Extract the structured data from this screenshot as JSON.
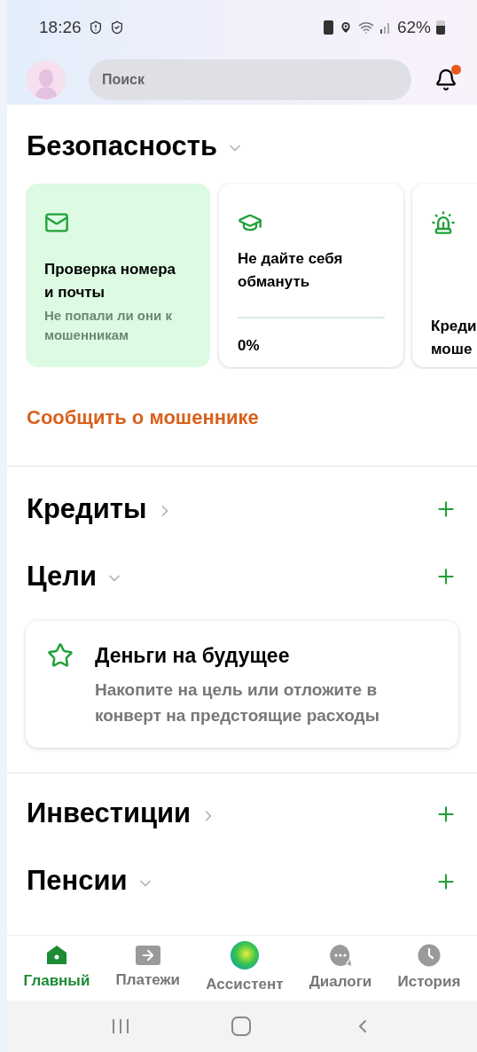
{
  "status_bar": {
    "time": "18:26",
    "battery": "62%"
  },
  "header": {
    "search": {
      "placeholder": "Поиск"
    },
    "notification_dot": true
  },
  "security": {
    "title": "Безопасность",
    "expanded": true,
    "cards": [
      {
        "kind": "check",
        "title": "Проверка номера и почты",
        "subtitle": "Не попали ли они к мошенникам",
        "selected": true
      },
      {
        "kind": "progress",
        "title": "Не дайте себя обмануть",
        "level": 0,
        "reading": "0%",
        "selected": false
      },
      {
        "kind": "alarm",
        "title": "Креди моше",
        "selected": false
      }
    ],
    "report_link": "Сообщить о мошеннике"
  },
  "sections": [
    {
      "kind": "plain",
      "title": "Кредиты",
      "expanded": false
    },
    {
      "kind": "goal",
      "title": "Цели",
      "expanded": true,
      "card": {
        "title": "Деньги на будущее",
        "text": "Накопите на цель или отложите в конверт на предстоящие расходы"
      }
    },
    {
      "kind": "plain",
      "title": "Инвестиции",
      "expanded": false,
      "divider_before": true
    },
    {
      "kind": "plain",
      "title": "Пенсии",
      "expanded": true
    }
  ],
  "tabs": [
    {
      "kind": "home",
      "label": "Главный",
      "selected": true
    },
    {
      "kind": "payments",
      "label": "Платежи",
      "selected": false
    },
    {
      "kind": "assistant",
      "label": "Ассистент",
      "selected": false
    },
    {
      "kind": "dialogs",
      "label": "Диалоги",
      "selected": false
    },
    {
      "kind": "history",
      "label": "История",
      "selected": false
    }
  ]
}
